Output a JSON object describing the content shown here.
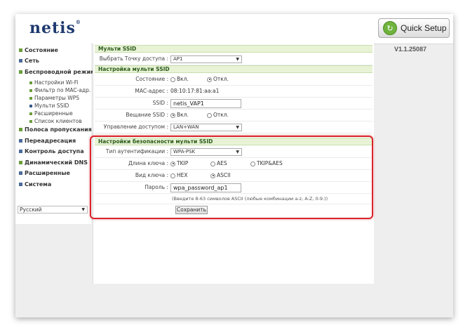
{
  "header": {
    "logo": "netis",
    "logo_mark": "®",
    "quick_setup_label": "Quick Setup",
    "version": "V1.1.25087"
  },
  "sidebar": {
    "items": [
      {
        "label": "Состояние"
      },
      {
        "label": "Сеть"
      },
      {
        "label": "Беспроводной режим"
      },
      {
        "label": "Полоса пропускания"
      },
      {
        "label": "Переадресация"
      },
      {
        "label": "Контроль доступа"
      },
      {
        "label": "Динамический DNS"
      },
      {
        "label": "Расширенные"
      },
      {
        "label": "Система"
      }
    ],
    "subitems": [
      {
        "label": "Настройки Wi-Fi"
      },
      {
        "label": "Фильтр по MAC-адр."
      },
      {
        "label": "Параметры WPS"
      },
      {
        "label": "Мульти SSID"
      },
      {
        "label": "Расширенные"
      },
      {
        "label": "Список клиентов"
      }
    ],
    "language": "Русский"
  },
  "multi_ssid": {
    "section_title": "Мульти SSID",
    "ap_label": "Выбрать Точку доступа :",
    "ap_value": "AP1"
  },
  "multi_ssid_settings": {
    "section_title": "Настройка мульти SSID",
    "state_label": "Состояние :",
    "state_on": "Вкл.",
    "state_off": "Откл.",
    "mac_label": "MAC-адрес :",
    "mac_value": "08:10:17:81:aa:a1",
    "ssid_label": "SSID :",
    "ssid_value": "netis_VAP1",
    "broadcast_label": "Вещание SSID :",
    "broadcast_on": "Вкл.",
    "broadcast_off": "Откл.",
    "access_label": "Управление доступом :",
    "access_value": "LAN+WAN"
  },
  "security": {
    "section_title": "Настройки безопасности мульти SSID",
    "auth_label": "Тип аутентификации :",
    "auth_value": "WPA-PSK",
    "keylen_label": "Длина ключа :",
    "keylen_tkip": "TKIP",
    "keylen_aes": "AES",
    "keylen_both": "TKIP&AES",
    "keytype_label": "Вид ключа :",
    "keytype_hex": "HEX",
    "keytype_ascii": "ASCII",
    "password_label": "Пароль :",
    "password_value": "wpa_password_ap1",
    "hint": "(Введите 8-63 символов ASCII (любые комбинации a-z, A-Z, 0-9.))",
    "save_label": "Сохранить"
  },
  "colors": {
    "section_bg": "#e8f3d6",
    "section_text": "#2b5b1a",
    "highlight": "#d9252b",
    "logo": "#1e3a6e",
    "quick_setup_icon": "#6fb33d"
  }
}
